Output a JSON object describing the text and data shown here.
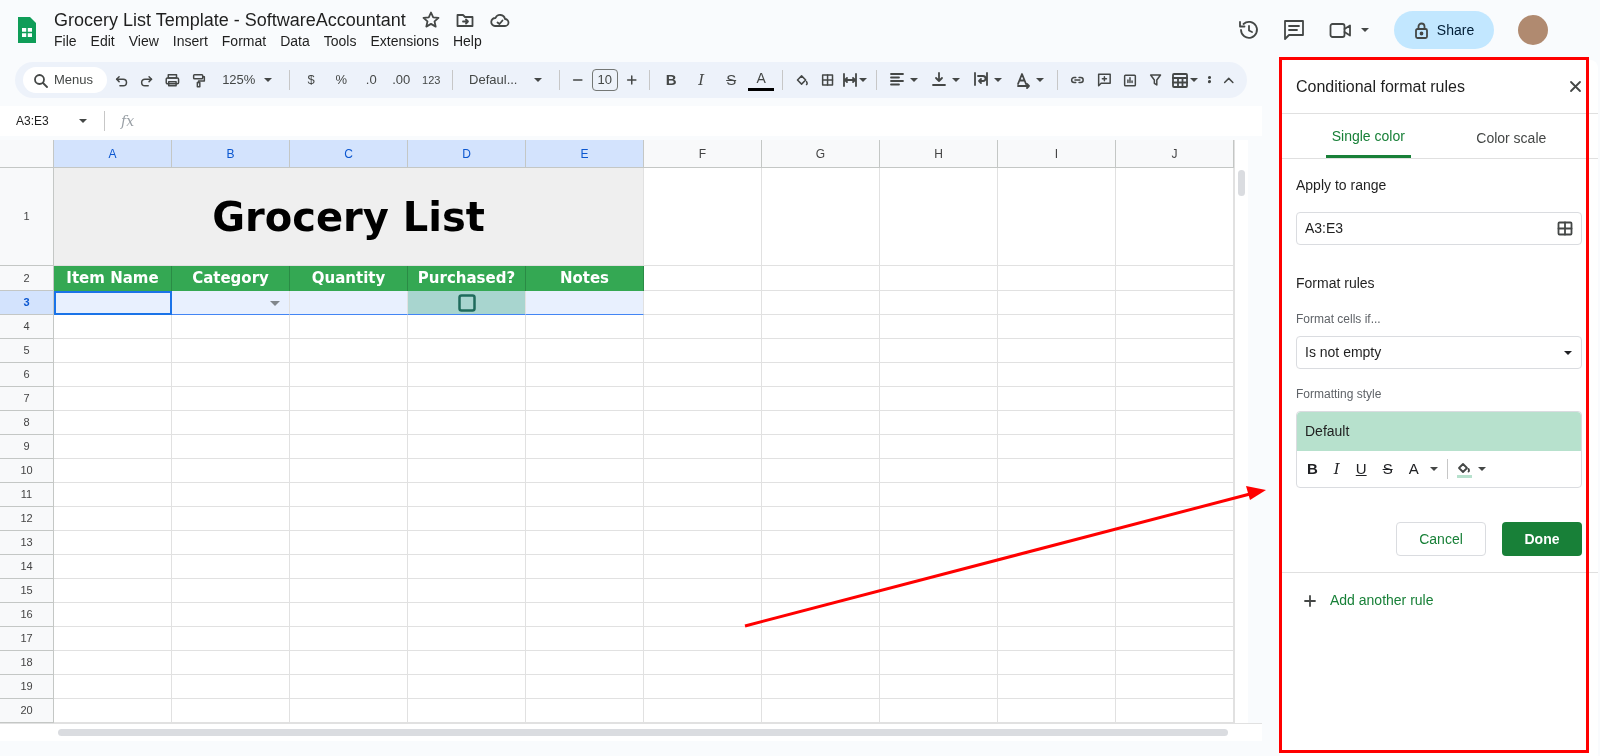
{
  "document": {
    "title": "Grocery List Template - SoftwareAccountant"
  },
  "menu": [
    "File",
    "Edit",
    "View",
    "Insert",
    "Format",
    "Data",
    "Tools",
    "Extensions",
    "Help"
  ],
  "share_button": "Share",
  "toolbar": {
    "search": "Menus",
    "zoom": "125%",
    "currency": "$",
    "percent": "%",
    "decrease_decimal": ".0",
    "increase_decimal": ".00",
    "number_format": "123",
    "font": "Defaul...",
    "font_size": "10",
    "bold": "B",
    "italic": "I",
    "strikethrough": "S",
    "text_color": "A"
  },
  "formula_bar": {
    "name_box": "A3:E3",
    "fx": "fx"
  },
  "sheet": {
    "columns": [
      {
        "label": "A",
        "selected": true
      },
      {
        "label": "B",
        "selected": true
      },
      {
        "label": "C",
        "selected": true
      },
      {
        "label": "D",
        "selected": true
      },
      {
        "label": "E",
        "selected": true
      },
      {
        "label": "F",
        "selected": false
      },
      {
        "label": "G",
        "selected": false
      },
      {
        "label": "H",
        "selected": false
      },
      {
        "label": "I",
        "selected": false
      },
      {
        "label": "J",
        "selected": false
      }
    ],
    "rows": [
      {
        "label": "1",
        "selected": false
      },
      {
        "label": "2",
        "selected": false
      },
      {
        "label": "3",
        "selected": true
      },
      {
        "label": "4",
        "selected": false
      },
      {
        "label": "5",
        "selected": false
      },
      {
        "label": "6",
        "selected": false
      },
      {
        "label": "7",
        "selected": false
      },
      {
        "label": "8",
        "selected": false
      },
      {
        "label": "9",
        "selected": false
      },
      {
        "label": "10",
        "selected": false
      },
      {
        "label": "11",
        "selected": false
      },
      {
        "label": "12",
        "selected": false
      },
      {
        "label": "13",
        "selected": false
      },
      {
        "label": "14",
        "selected": false
      },
      {
        "label": "15",
        "selected": false
      },
      {
        "label": "16",
        "selected": false
      },
      {
        "label": "17",
        "selected": false
      },
      {
        "label": "18",
        "selected": false
      },
      {
        "label": "19",
        "selected": false
      },
      {
        "label": "20",
        "selected": false
      }
    ],
    "title": "Grocery List",
    "headers": [
      "Item Name",
      "Category",
      "Quantity",
      "Purchased?",
      "Notes"
    ],
    "row_3": [
      {
        "kind": "text",
        "active": true
      },
      {
        "kind": "dropdown",
        "active": false
      },
      {
        "kind": "text",
        "active": false
      },
      {
        "kind": "checkbox",
        "checked": false,
        "active": false
      },
      {
        "kind": "text",
        "active": false
      }
    ]
  },
  "panel": {
    "title": "Conditional format rules",
    "tabs": [
      {
        "label": "Single color",
        "selected": true
      },
      {
        "label": "Color scale",
        "selected": false
      }
    ],
    "range_label": "Apply to range",
    "range_value": "A3:E3",
    "rules_heading": "Format rules",
    "condition_label": "Format cells if...",
    "condition": "Is not empty",
    "style_label": "Formatting style",
    "style_preview": "Default",
    "style_buttons": [
      "B",
      "I",
      "U",
      "S",
      "A"
    ],
    "cancel": "Cancel",
    "done": "Done",
    "add_rule": "Add another rule"
  }
}
